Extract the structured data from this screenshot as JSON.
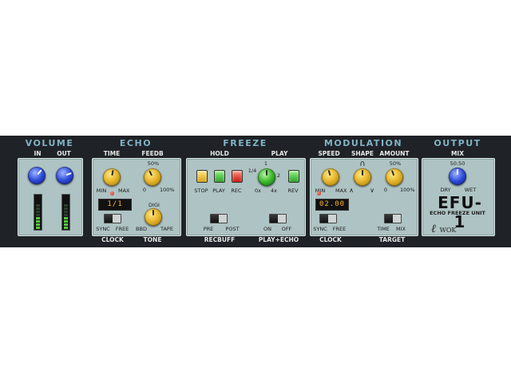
{
  "sections": {
    "volume": "VOLUME",
    "echo": "ECHO",
    "freeze": "FREEZE",
    "modulation": "MODULATION",
    "output": "OUTPUT"
  },
  "volume": {
    "in_label": "IN",
    "out_label": "OUT",
    "in_meter_level": 0.45,
    "out_meter_level": 0.45
  },
  "echo": {
    "time_label": "TIME",
    "feedb_label": "FEEDB",
    "time_min": "MIN",
    "time_max": "MAX",
    "feedb_top": "50%",
    "feedb_min": "0",
    "feedb_max": "100%",
    "display": "1/1",
    "sync": "SYNC",
    "free": "FREE",
    "clock": "CLOCK",
    "digi": "DIGI",
    "bbd": "BBD",
    "tape": "TAPE",
    "tone": "TONE"
  },
  "freeze": {
    "hold": "HOLD",
    "play": "PLAY",
    "stop": "STOP",
    "play_btn": "PLAY",
    "rec": "REC",
    "quarter": "1/4",
    "one": "1",
    "two": "2",
    "zero_x": "0x",
    "four_x": "4x",
    "rev": "REV",
    "pre": "PRE",
    "post": "POST",
    "recbuff": "RECBUFF",
    "on": "ON",
    "off": "OFF",
    "play_echo": "PLAY+ECHO"
  },
  "modulation": {
    "speed": "SPEED",
    "shape": "SHAPE",
    "amount": "AMOUNT",
    "speed_min": "MIN",
    "speed_max": "MAX",
    "amount_top": "50%",
    "amount_min": "0",
    "amount_max": "100%",
    "shape_top": "∩",
    "display": "02.00",
    "sync": "SYNC",
    "free": "FREE",
    "clock": "CLOCK",
    "time": "TIME",
    "mix": "MIX",
    "target": "TARGET"
  },
  "output": {
    "mix": "MIX",
    "mix_top": "50:50",
    "dry": "DRY",
    "wet": "WET",
    "product": "EFU-1",
    "subtitle": "ECHO FREEZE UNIT",
    "brand": "WOK"
  },
  "colors": {
    "accent_title": "#7fb3c4",
    "panel": "#aec3c3",
    "strip": "#1f2226",
    "lcd_text": "#ffb020"
  }
}
